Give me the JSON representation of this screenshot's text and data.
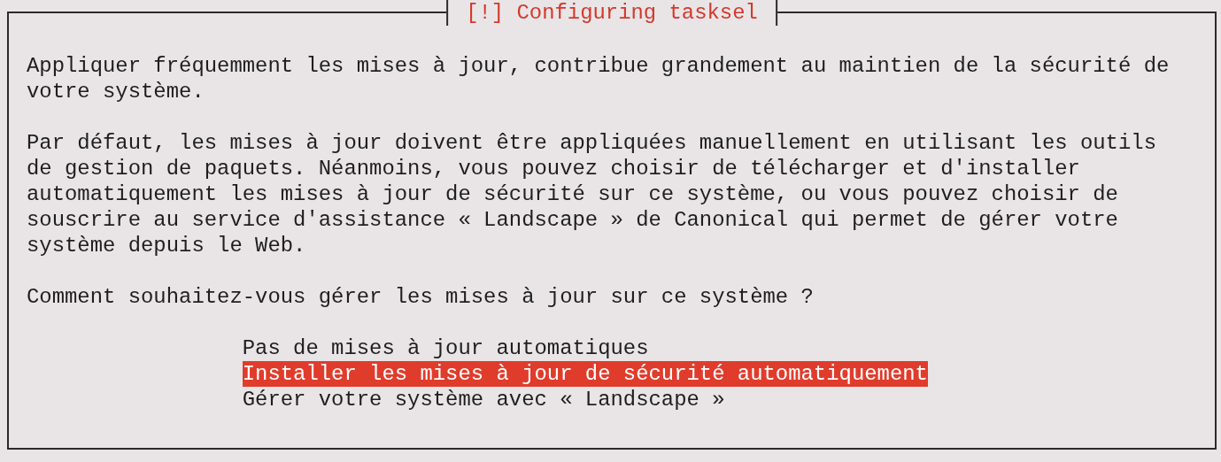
{
  "dialog": {
    "title": "[!] Configuring tasksel",
    "paragraphs": [
      "Appliquer fréquemment les mises à jour, contribue grandement au maintien de la sécurité de votre système.",
      "Par défaut, les mises à jour doivent être appliquées manuellement en utilisant les outils de gestion de paquets. Néanmoins, vous pouvez choisir de télécharger et d'installer automatiquement les mises à jour de sécurité sur ce système, ou vous pouvez choisir de souscrire au service d'assistance « Landscape » de Canonical qui permet de gérer votre système depuis le Web.",
      "Comment souhaitez-vous gérer les mises à jour sur ce système ?"
    ],
    "options": [
      {
        "label": "Pas de mises à jour automatiques",
        "selected": false
      },
      {
        "label": "Installer les mises à jour de sécurité automatiquement",
        "selected": true
      },
      {
        "label": "Gérer votre système avec « Landscape »",
        "selected": false
      }
    ]
  }
}
